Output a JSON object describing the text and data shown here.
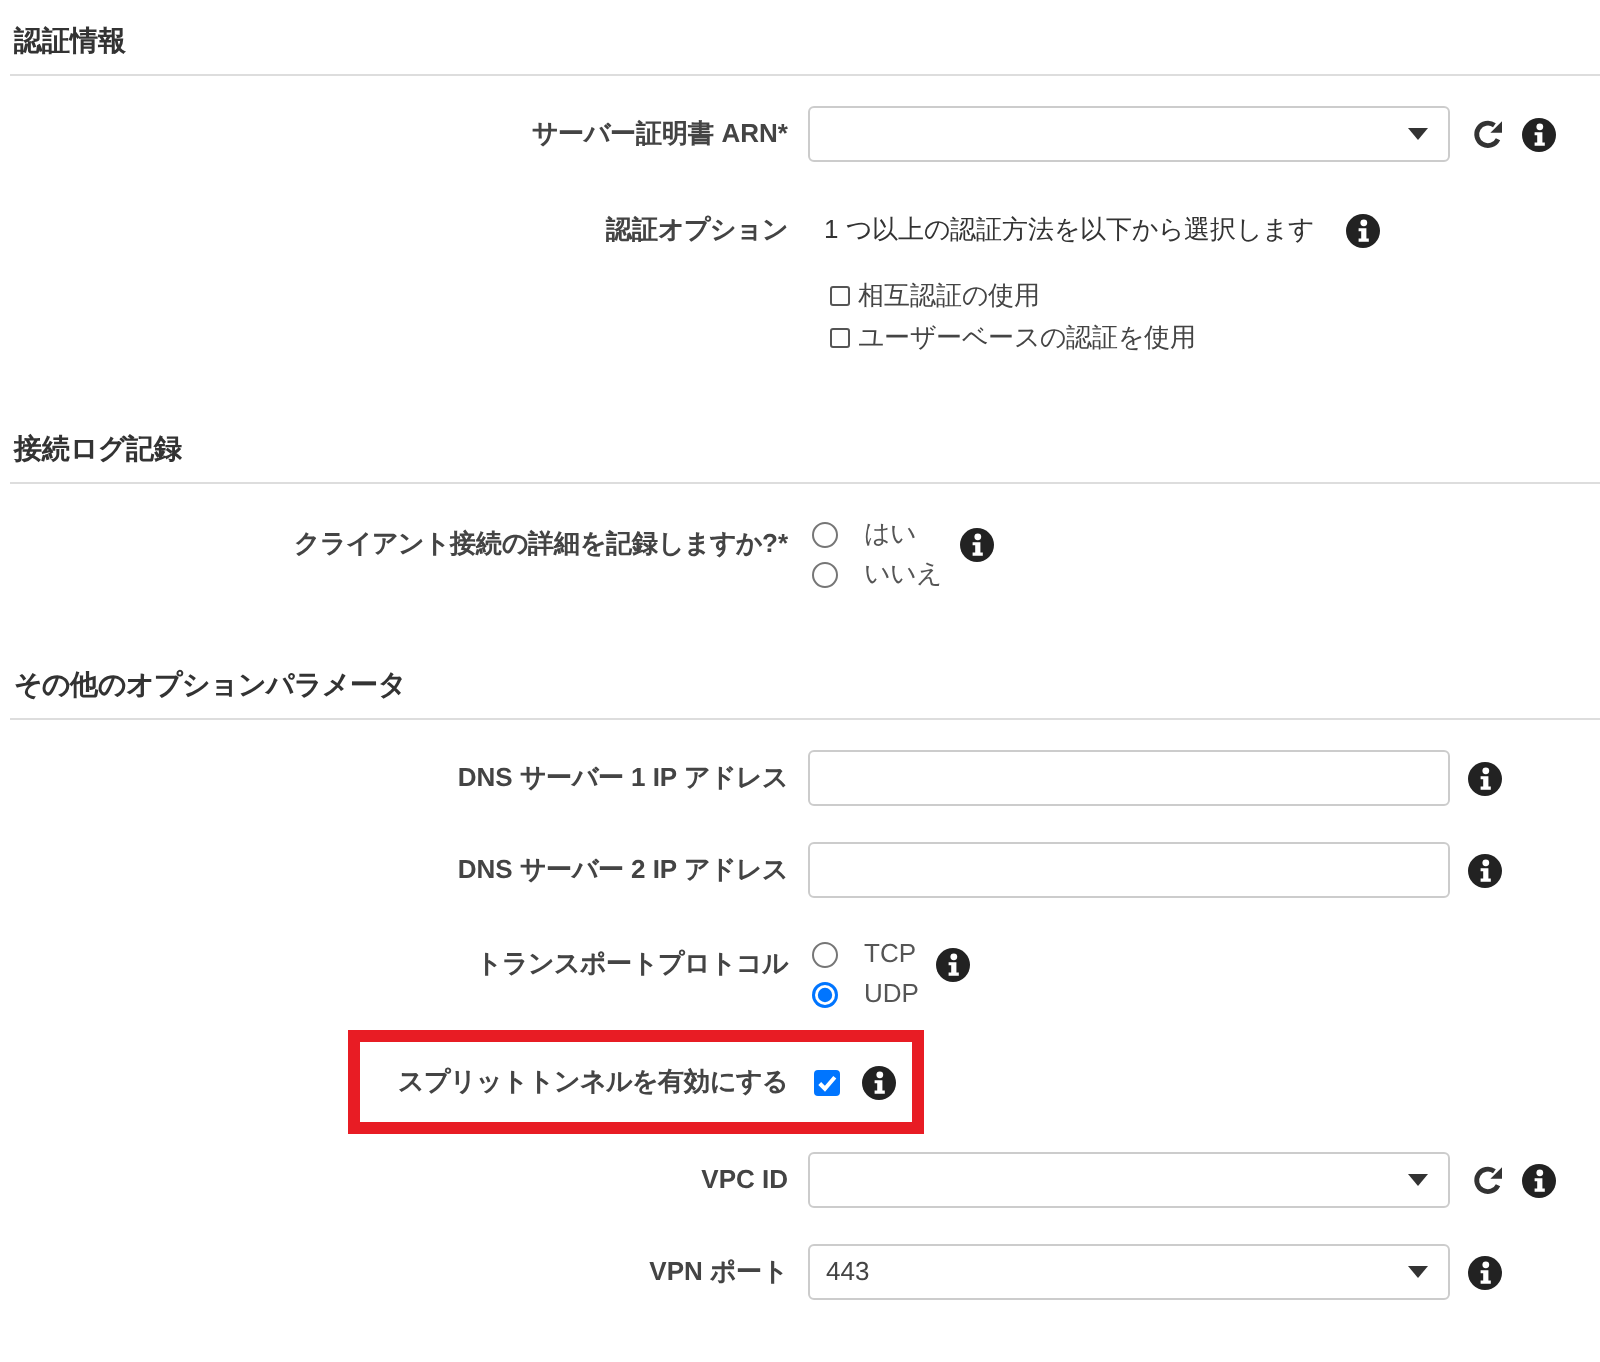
{
  "sections": [
    {
      "title": "認証情報",
      "fields": [
        {
          "kind": "select",
          "label": "サーバー証明書 ARN*",
          "refresh": true,
          "info": true,
          "highlighted": false
        },
        {
          "kind": "checkbox-group",
          "label": "認証オプション",
          "description": "1 つ以上の認証方法を以下から選択します",
          "info": true,
          "highlighted": false,
          "options": [
            {
              "label": "相互認証の使用",
              "checked": false
            },
            {
              "label": "ユーザーベースの認証を使用",
              "checked": false
            }
          ]
        }
      ]
    },
    {
      "title": "接続ログ記録",
      "fields": [
        {
          "kind": "radio-group",
          "label": "クライアント接続の詳細を記録しますか?*",
          "info": true,
          "highlighted": false,
          "options": [
            {
              "label": "はい",
              "selected": false
            },
            {
              "label": "いいえ",
              "selected": false
            }
          ]
        }
      ]
    },
    {
      "title": "その他のオプションパラメータ",
      "fields": [
        {
          "kind": "text",
          "label": "DNS サーバー 1 IP アドレス",
          "info": true,
          "highlighted": false
        },
        {
          "kind": "text",
          "label": "DNS サーバー 2 IP アドレス",
          "info": true,
          "highlighted": false
        },
        {
          "kind": "radio-group",
          "label": "トランスポートプロトコル",
          "info": true,
          "highlighted": false,
          "options": [
            {
              "label": "TCP",
              "selected": false
            },
            {
              "label": "UDP",
              "selected": true
            }
          ]
        },
        {
          "kind": "checkbox",
          "label": "スプリットトンネルを有効にする",
          "checked": true,
          "info": true,
          "highlighted": true
        },
        {
          "kind": "select",
          "label": "VPC ID",
          "refresh": true,
          "info": true,
          "highlighted": false
        },
        {
          "kind": "select",
          "label": "VPN ポート",
          "value": "443",
          "refresh": false,
          "info": true,
          "highlighted": false
        }
      ]
    }
  ]
}
